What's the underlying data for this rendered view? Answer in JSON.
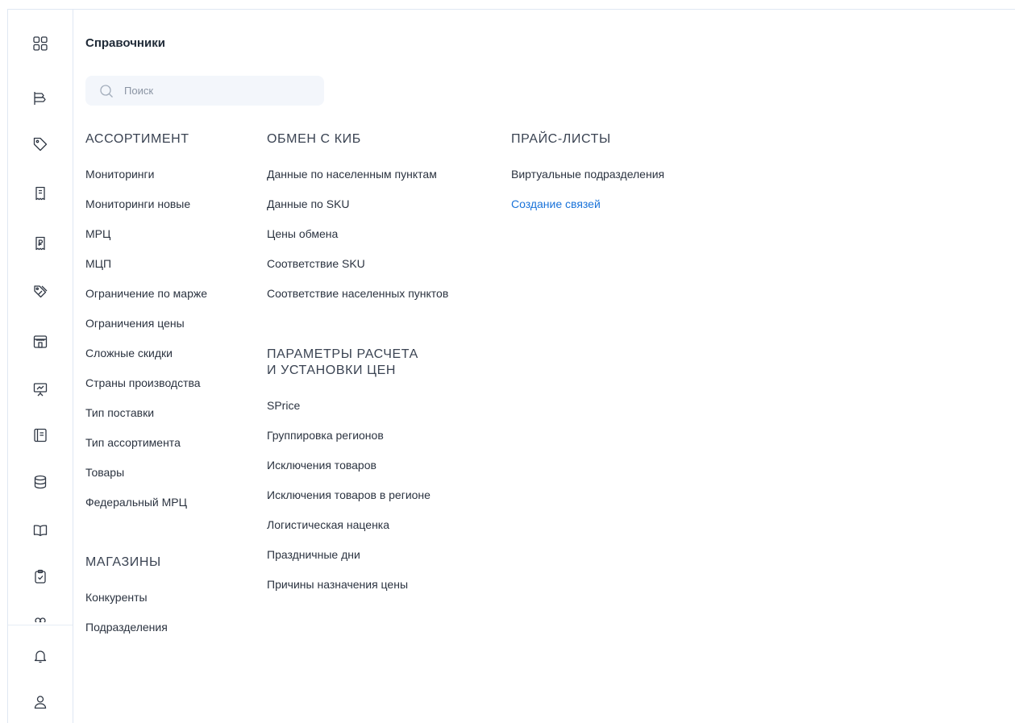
{
  "rail": {
    "icons": [
      {
        "name": "dashboard-grid-icon"
      },
      {
        "name": "flag-bars-icon"
      },
      {
        "name": "price-tag-icon"
      },
      {
        "name": "receipt-icon"
      },
      {
        "name": "ruble-receipt-icon"
      },
      {
        "name": "discount-tags-icon"
      },
      {
        "name": "store-icon"
      },
      {
        "name": "presentation-board-icon"
      },
      {
        "name": "catalog-book-icon"
      },
      {
        "name": "database-icon"
      },
      {
        "name": "open-book-icon"
      },
      {
        "name": "clipboard-check-icon"
      },
      {
        "name": "users-icon"
      },
      {
        "name": "bell-icon"
      },
      {
        "name": "user-profile-icon"
      }
    ]
  },
  "page": {
    "title": "Справочники"
  },
  "search": {
    "placeholder": "Поиск"
  },
  "sections": {
    "assortment": {
      "title": "АССОРТИМЕНТ",
      "items": [
        "Мониторинги",
        "Мониторинги новые",
        "МРЦ",
        "МЦП",
        "Ограничение по марже",
        "Ограничения цены",
        "Сложные скидки",
        "Страны производства",
        "Тип поставки",
        "Тип ассортимента",
        "Товары",
        "Федеральный МРЦ"
      ]
    },
    "stores": {
      "title": "МАГАЗИНЫ",
      "items": [
        "Конкуренты",
        "Подразделения"
      ]
    },
    "kib": {
      "title": "ОБМЕН С КИБ",
      "items": [
        "Данные по населенным пунктам",
        "Данные по SKU",
        "Цены обмена",
        "Соответствие SKU",
        "Соответствие населенных пунктов"
      ]
    },
    "pricing": {
      "title_line1": "ПАРАМЕТРЫ РАСЧЕТА",
      "title_line2": "И УСТАНОВКИ ЦЕН",
      "items": [
        "SPrice",
        "Группировка регионов",
        "Исключения товаров",
        "Исключения товаров в регионе",
        "Логистическая наценка",
        "Праздничные дни",
        "Причины назначения цены"
      ]
    },
    "pricelists": {
      "title": "ПРАЙС-ЛИСТЫ",
      "items": [
        "Виртуальные подразделения",
        "Создание связей"
      ]
    }
  },
  "colors": {
    "accent": "#1a73d9",
    "text": "#2b3340",
    "search_bg": "#f3f6fb",
    "border": "#dfe7f2"
  }
}
